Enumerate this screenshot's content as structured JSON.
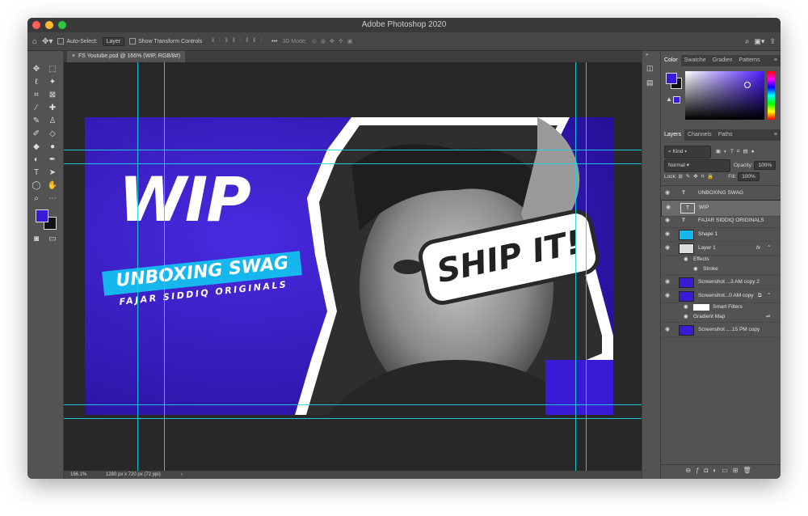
{
  "window": {
    "title": "Adobe Photoshop 2020"
  },
  "options_bar": {
    "auto_select_label": "Auto-Select:",
    "auto_select_value": "Layer",
    "show_transform_label": "Show Transform Controls",
    "mode_3d_label": "3D Mode:"
  },
  "document": {
    "tab_title": "FS Youtube.psd @ 166% (WIP, RGB/8#)",
    "zoom": "166.1%",
    "dimensions": "1280 px x 720 px (72 ppi)"
  },
  "artwork": {
    "headline": "WIP",
    "banner_text": "UNBOXING SWAG",
    "subtitle": "FAJAR SIDDIQ ORIGINALS",
    "sticker_text": "SHIP IT!"
  },
  "color_panel": {
    "tabs": [
      "Color",
      "Swatche",
      "Gradien",
      "Patterns"
    ],
    "foreground": "#3b1ad6",
    "background": "#111111"
  },
  "layers_panel": {
    "tabs": [
      "Layers",
      "Channels",
      "Paths"
    ],
    "filter_kind": "Kind",
    "blend_mode": "Normal",
    "opacity_label": "Opacity:",
    "opacity_value": "100%",
    "lock_label": "Lock:",
    "fill_label": "Fill:",
    "fill_value": "100%",
    "layers": [
      {
        "name": "UNBOXING SWAG",
        "kind": "text"
      },
      {
        "name": "WIP",
        "kind": "text",
        "selected": true
      },
      {
        "name": "FAJAR SIDDIQ ORIGINALS",
        "kind": "text"
      },
      {
        "name": "Shape 1",
        "kind": "shape"
      },
      {
        "name": "Layer 1",
        "kind": "image",
        "fx": "fx"
      },
      {
        "name": "Effects",
        "kind": "sub"
      },
      {
        "name": "Stroke",
        "kind": "sub2"
      },
      {
        "name": "Screenshot ...3 AM copy 2",
        "kind": "image"
      },
      {
        "name": "Screenshot...0 AM copy",
        "kind": "smart"
      },
      {
        "name": "Smart Filters",
        "kind": "sub2"
      },
      {
        "name": "Gradient Map",
        "kind": "sub"
      },
      {
        "name": "Screenshot ....15 PM copy",
        "kind": "image"
      }
    ]
  },
  "colors": {
    "accent_purple": "#3b1ad6",
    "guide_cyan": "#19d6e6",
    "banner_cyan": "#16b6ef"
  }
}
